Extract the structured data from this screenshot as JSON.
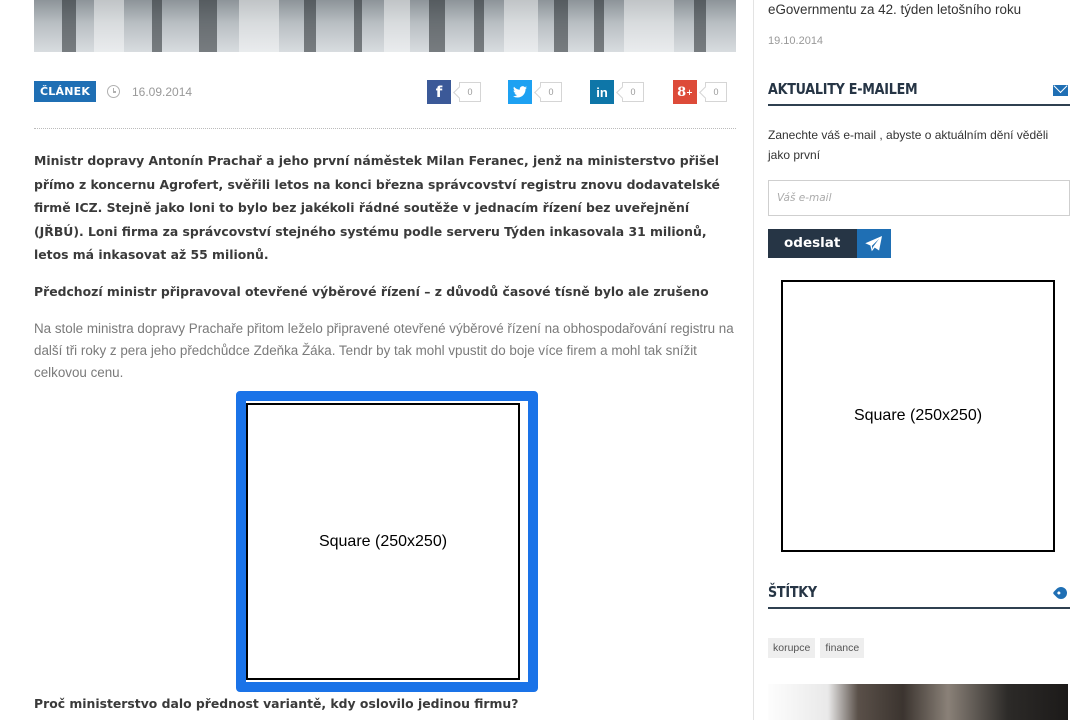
{
  "article": {
    "badge": "ČLÁNEK",
    "date": "16.09.2014",
    "share": [
      {
        "network": "facebook",
        "icon": "facebook-icon",
        "glyph": "f",
        "color": "#3b5998",
        "count": "0"
      },
      {
        "network": "twitter",
        "icon": "twitter-icon",
        "glyph": "t",
        "color": "#1da1f2",
        "count": "0"
      },
      {
        "network": "linkedin",
        "icon": "linkedin-icon",
        "glyph": "in",
        "color": "#0e76a8",
        "count": "0"
      },
      {
        "network": "googleplus",
        "icon": "google-plus-icon",
        "glyph": "8+",
        "color": "#dd4b39",
        "count": "0"
      }
    ],
    "lead": "Ministr dopravy Antonín Prachař a jeho první náměstek Milan Feranec, jenž na ministerstvo přišel přímo z koncernu Agrofert, svěřili letos na konci března správcovství registru znovu dodavatelské firmě ICZ. Stejně jako loni to bylo bez jakékoli řádné soutěže v jednacím řízení bez uveřejnění (JŘBÚ). Loni firma za správcovství stejného systému podle serveru Týden inkasovala 31 milionů, letos má inkasovat až 55 milionů.",
    "subhead1": "Předchozí ministr připravoval otevřené výběrové řízení – z důvodů časové tísně bylo ale zrušeno",
    "paragraph1": "Na stole ministra dopravy Prachaře přitom leželo připravené otevřené výběrové řízení na obhospodařování registru na další tři roky z pera jeho předchůdce Zdeňka Žáka. Tendr by tak mohl vpustit do boje více firem a mohl tak snížit celkovou cenu.",
    "ad_label": "Square (250x250)",
    "subhead2": "Proč ministerstvo dalo přednost variantě, kdy oslovilo jedinou firmu?"
  },
  "sidebar": {
    "prev_item_title": "eGovernmentu za 42. týden letošního roku",
    "prev_item_date": "19.10.2014",
    "newsletter": {
      "title": "AKTUALITY E-MAILEM",
      "icon": "envelope-icon",
      "description": "Zanechte váš e-mail , abyste o aktuálním dění věděli jako první",
      "email_placeholder": "Váš e-mail",
      "email_value": "",
      "submit_label": "odeslat",
      "submit_icon": "paper-plane-icon"
    },
    "ad_label": "Square (250x250)",
    "tags": {
      "title": "ŠTÍTKY",
      "icon": "tag-icon",
      "items": [
        "korupce",
        "finance"
      ]
    }
  }
}
